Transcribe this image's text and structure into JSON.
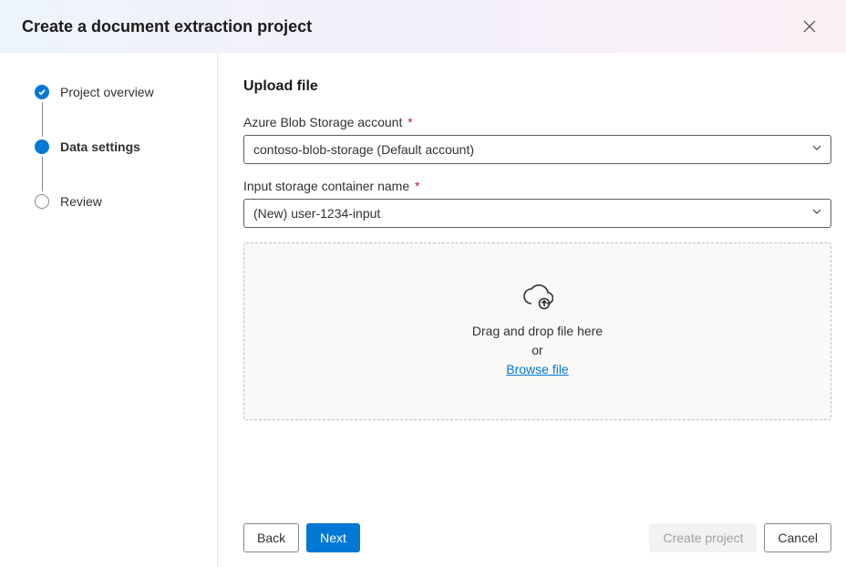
{
  "header": {
    "title": "Create a document extraction project"
  },
  "steps": [
    {
      "label": "Project overview",
      "state": "completed"
    },
    {
      "label": "Data settings",
      "state": "current"
    },
    {
      "label": "Review",
      "state": "upcoming"
    }
  ],
  "section": {
    "title": "Upload file"
  },
  "fields": {
    "storage_account": {
      "label": "Azure Blob Storage account",
      "required": "*",
      "value": "contoso-blob-storage (Default account)"
    },
    "container": {
      "label": "Input storage container name",
      "required": "*",
      "value": "(New) user-1234-input"
    }
  },
  "dropzone": {
    "line1": "Drag and drop file here",
    "line2": "or",
    "link": "Browse file"
  },
  "footer": {
    "back": "Back",
    "next": "Next",
    "create": "Create project",
    "cancel": "Cancel"
  }
}
